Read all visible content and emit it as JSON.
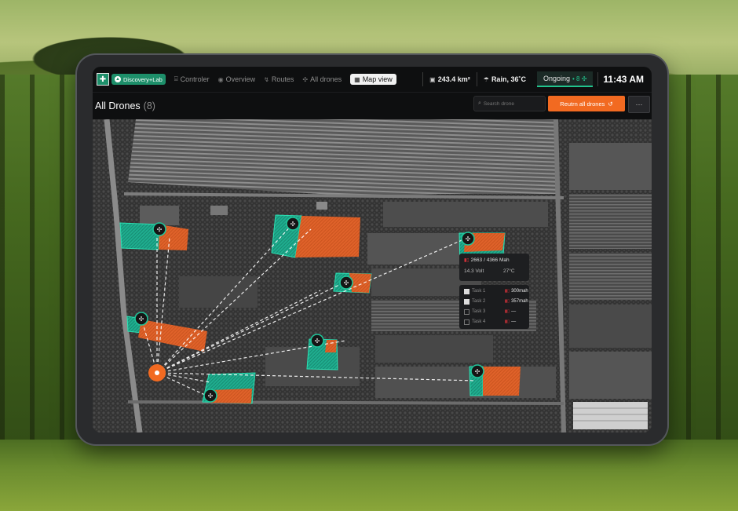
{
  "app": {
    "brand_label": "Discovery+Lab",
    "nav": [
      {
        "label": "Controler",
        "icon": "gamepad-icon"
      },
      {
        "label": "Overview",
        "icon": "eye-icon"
      },
      {
        "label": "Routes",
        "icon": "route-icon"
      },
      {
        "label": "All drones",
        "icon": "drone-icon"
      },
      {
        "label": "Map view",
        "icon": "map-icon",
        "active": true
      }
    ],
    "area": "243.4 km²",
    "weather": "Rain, 36˚C",
    "status_label": "Ongoing",
    "status_count": "8",
    "time": "11:43 AM"
  },
  "header": {
    "title": "All Drones",
    "count": "(8)",
    "search_placeholder": "Search drone",
    "return_label": "Reutrn all drones",
    "more_label": "···"
  },
  "drone_panel": {
    "battery": "2663",
    "battery_total": "/ 4366 Mah",
    "voltage": "14.3 Volt",
    "temperature": "27°C",
    "tasks": [
      {
        "name": "Task 1",
        "value": "300mah",
        "checked": true
      },
      {
        "name": "Task 2",
        "value": "357mah",
        "checked": true
      },
      {
        "name": "Task 3",
        "value": "—",
        "checked": false
      },
      {
        "name": "Task 4",
        "value": "—",
        "checked": false
      }
    ]
  },
  "colors": {
    "accent_orange": "#f26a21",
    "teal": "#1dbf98",
    "ongoing_green": "#21c48d"
  }
}
